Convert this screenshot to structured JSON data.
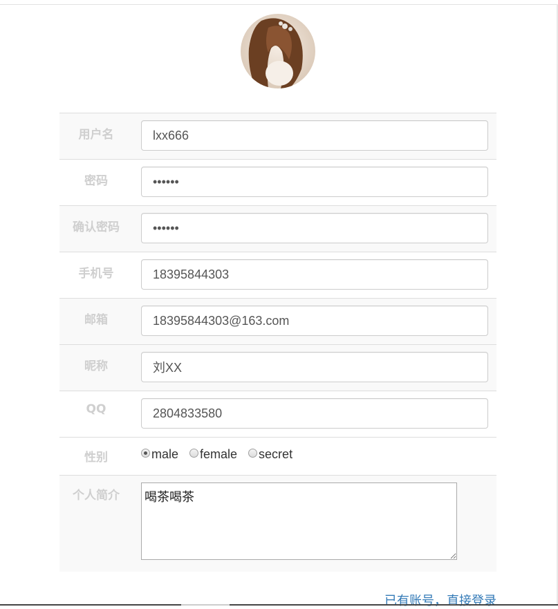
{
  "form": {
    "username": {
      "label": "用户名",
      "value": "lxx666"
    },
    "password": {
      "label": "密码",
      "value": "••••••"
    },
    "confirm_password": {
      "label": "确认密码",
      "value": "••••••"
    },
    "phone": {
      "label": "手机号",
      "value": "18395844303"
    },
    "email": {
      "label": "邮箱",
      "value": "18395844303@163.com"
    },
    "nickname": {
      "label": "昵称",
      "value": "刘XX"
    },
    "qq": {
      "label": "QQ",
      "value": "2804833580"
    },
    "gender": {
      "label": "性别",
      "selected": "male",
      "options": [
        {
          "label": "male"
        },
        {
          "label": "female"
        },
        {
          "label": "secret"
        }
      ]
    },
    "bio": {
      "label": "个人简介",
      "value": "喝茶喝茶"
    }
  },
  "login_link": "已有账号，直接登录"
}
